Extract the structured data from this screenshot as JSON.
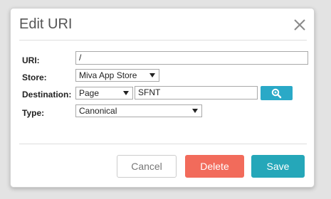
{
  "dialog": {
    "title": "Edit URI"
  },
  "form": {
    "uri": {
      "label": "URI:",
      "value": "/"
    },
    "store": {
      "label": "Store:",
      "selected": "Miva App Store"
    },
    "destination": {
      "label": "Destination:",
      "type_selected": "Page",
      "value": "SFNT"
    },
    "type": {
      "label": "Type:",
      "selected": "Canonical"
    }
  },
  "buttons": {
    "cancel": "Cancel",
    "delete": "Delete",
    "save": "Save"
  },
  "icons": {
    "close": "close-icon",
    "search": "search-icon"
  },
  "colors": {
    "delete": "#f26b5b",
    "save": "#25a7b9",
    "search": "#2aa9c7"
  }
}
